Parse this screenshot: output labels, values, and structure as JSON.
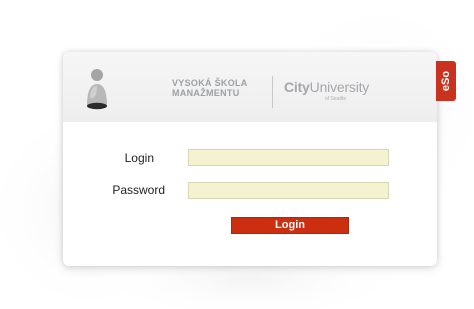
{
  "logo": {
    "school_line1": "VYSOKÁ ŠKOLA",
    "school_line2": "MANAŽMENTU",
    "city_part1": "City",
    "city_part2": "University",
    "city_sub": "of Seattle"
  },
  "tab": {
    "label": "eSo"
  },
  "form": {
    "login_label": "Login",
    "password_label": "Password",
    "login_value": "",
    "password_value": "",
    "submit_label": "Login"
  },
  "icons": {
    "user": "user-silhouette-icon"
  },
  "colors": {
    "accent": "#cc2f10",
    "field_bg": "#f5f3cf"
  }
}
